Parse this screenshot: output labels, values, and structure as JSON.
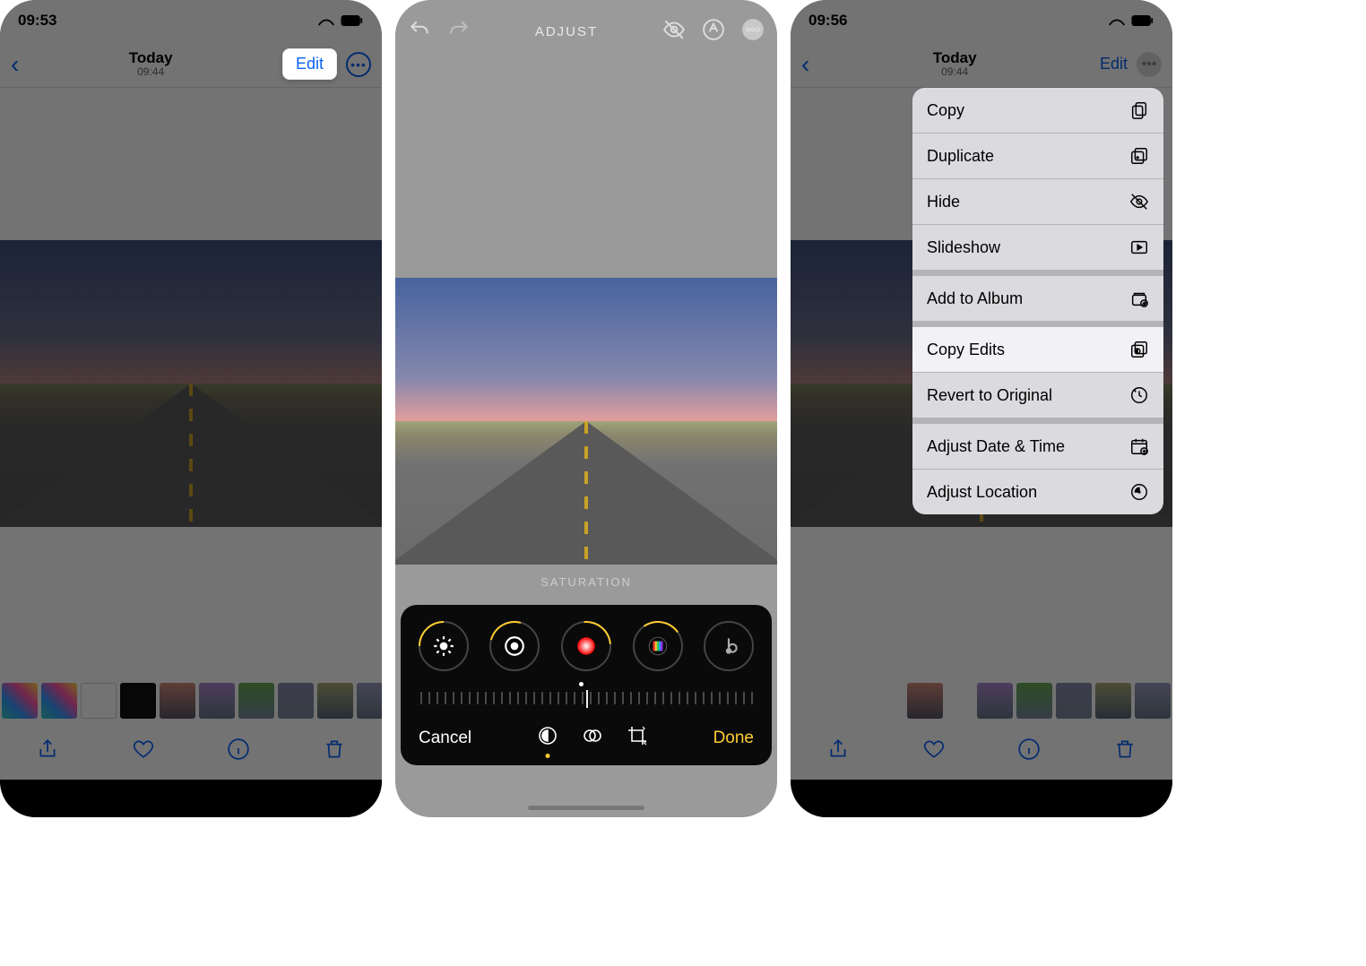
{
  "screen1": {
    "status_time": "09:53",
    "nav_title": "Today",
    "nav_subtitle": "09:44",
    "edit_label": "Edit"
  },
  "screen2": {
    "top_title": "ADJUST",
    "param_label": "SATURATION",
    "cancel_label": "Cancel",
    "done_label": "Done",
    "dials": [
      "brightness",
      "exposure",
      "saturation",
      "vibrance",
      "warmth"
    ]
  },
  "screen3": {
    "status_time": "09:56",
    "nav_title": "Today",
    "nav_subtitle": "09:44",
    "edit_label": "Edit",
    "menu": {
      "copy": "Copy",
      "duplicate": "Duplicate",
      "hide": "Hide",
      "slideshow": "Slideshow",
      "add_album": "Add to Album",
      "copy_edits": "Copy Edits",
      "revert": "Revert to Original",
      "adjust_dt": "Adjust Date & Time",
      "adjust_loc": "Adjust Location"
    }
  }
}
